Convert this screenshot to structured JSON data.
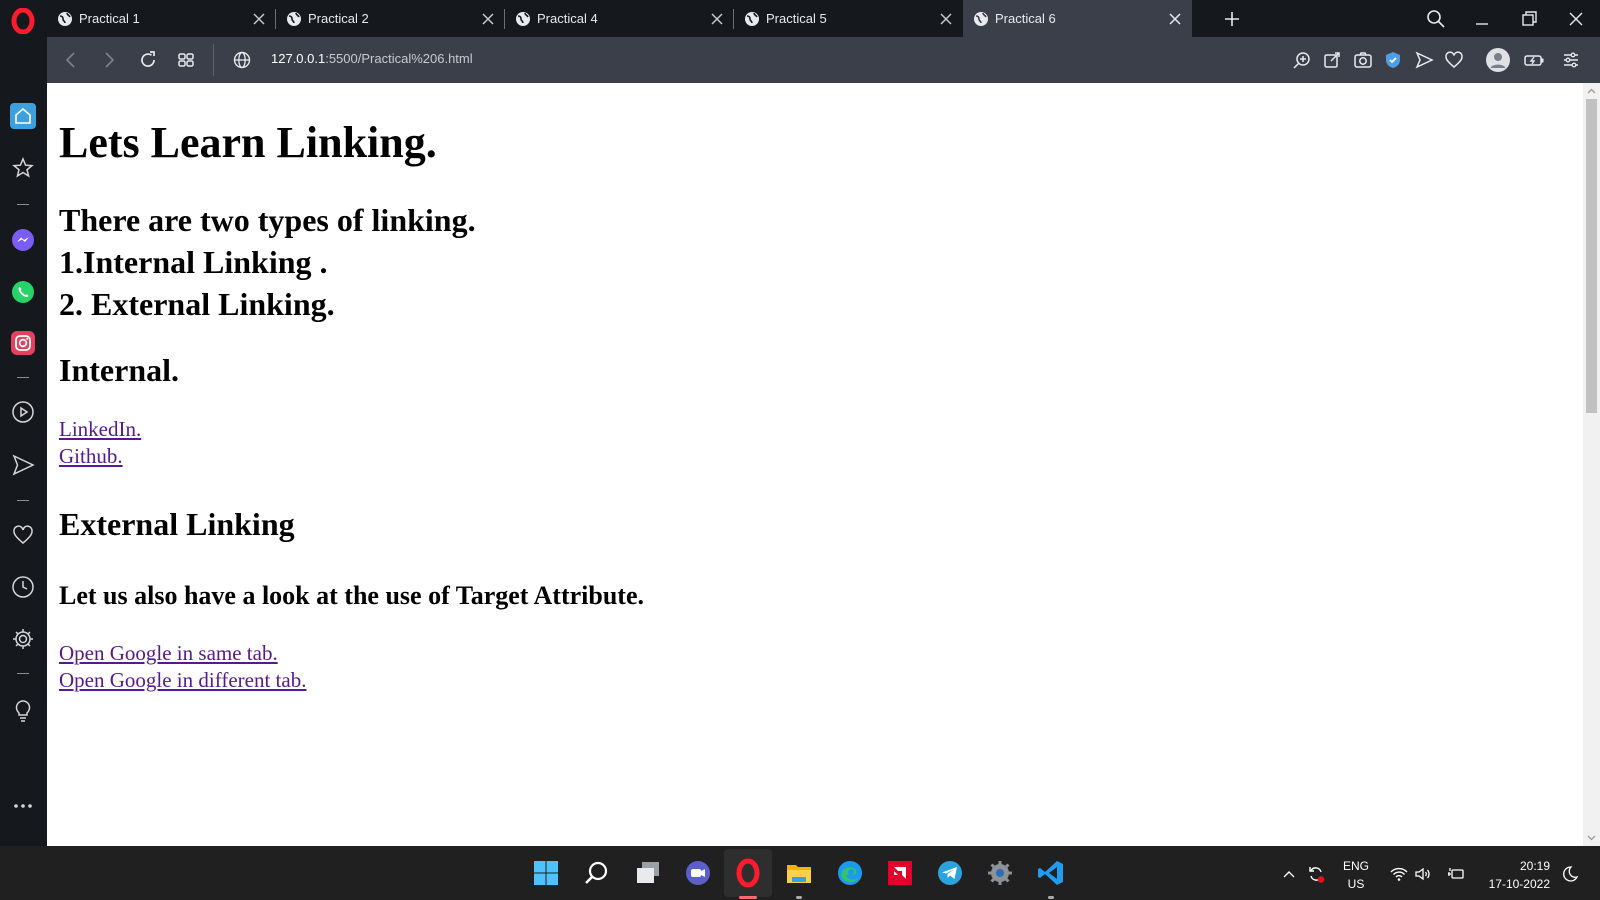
{
  "browser": {
    "tabs": [
      {
        "label": "Practical 1",
        "active": false
      },
      {
        "label": "Practical 2",
        "active": false
      },
      {
        "label": "Practical 4",
        "active": false
      },
      {
        "label": "Practical 5",
        "active": false
      },
      {
        "label": "Practical 6",
        "active": true
      }
    ],
    "url_host": "127.0.0.1",
    "url_path": ":5500/Practical%206.html"
  },
  "page": {
    "title": "Lets Learn Linking.",
    "types_heading_line1": "There are two types of linking.",
    "types_heading_line2": "1.Internal Linking .",
    "types_heading_line3": "2. External Linking.",
    "internal_heading": "Internal.",
    "internal_links": [
      "LinkedIn.",
      "Github."
    ],
    "external_heading": "External Linking",
    "target_heading": "Let us also have a look at the use of Target Attribute.",
    "external_links": [
      "Open Google in same tab.",
      "Open Google in different tab."
    ]
  },
  "taskbar": {
    "language_line1": "ENG",
    "language_line2": "US",
    "time": "20:19",
    "date": "17-10-2022"
  },
  "colors": {
    "accent_opera": "#ff1b2d",
    "visited_link": "#551a8b",
    "sidebar_home_active": "#3ba0dd"
  },
  "icons": {
    "sidebar": [
      "home-icon",
      "star-icon",
      "messenger-icon",
      "whatsapp-icon",
      "instagram-icon",
      "player-icon",
      "send-icon",
      "heart-icon",
      "history-icon",
      "settings-icon",
      "lightbulb-icon",
      "more-icon"
    ],
    "taskbar": [
      "windows-start-icon",
      "search-icon",
      "task-view-icon",
      "teams-chat-icon",
      "opera-icon",
      "file-explorer-icon",
      "edge-icon",
      "amd-icon",
      "telegram-icon",
      "settings-icon",
      "vscode-icon"
    ]
  }
}
